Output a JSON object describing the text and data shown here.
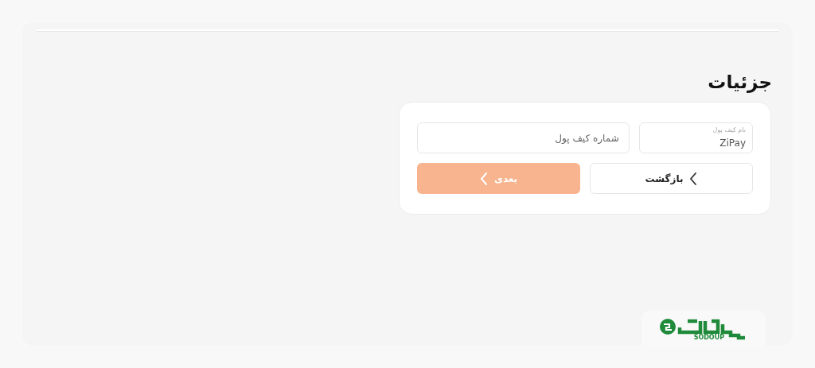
{
  "title": "جزئیات",
  "fields": [
    {
      "kind": "labeled",
      "label": "نام کیف پول",
      "value": "ZiPay"
    },
    {
      "kind": "input",
      "placeholder": "شماره کیف پول"
    }
  ],
  "buttons": [
    {
      "kind": "back",
      "label": "بازگشت",
      "disabled": false
    },
    {
      "kind": "next",
      "label": "بعدی",
      "disabled": true
    }
  ],
  "logo": {
    "caption": "SODOUP"
  }
}
